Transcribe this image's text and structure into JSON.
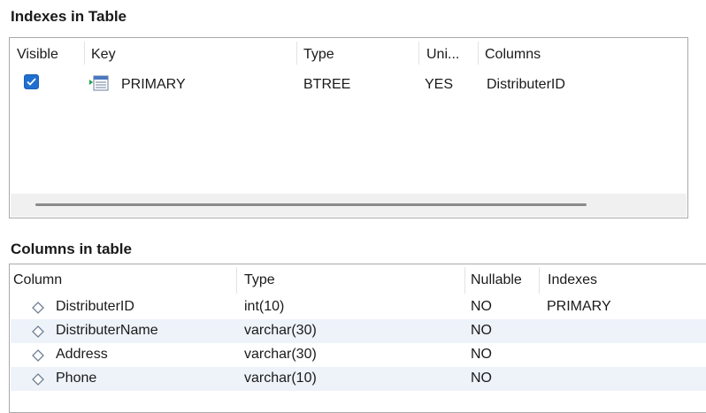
{
  "indexes": {
    "title": "Indexes in Table",
    "columns": [
      "Visible",
      "Key",
      "Type",
      "Uni...",
      "Columns"
    ],
    "rows": [
      {
        "visible": true,
        "key": "PRIMARY",
        "type": "BTREE",
        "unique": "YES",
        "columns": "DistributerID"
      }
    ]
  },
  "table_columns": {
    "title": "Columns in table",
    "columns": [
      "Column",
      "Type",
      "Nullable",
      "Indexes"
    ],
    "rows": [
      {
        "name": "DistributerID",
        "type": "int(10)",
        "nullable": "NO",
        "indexes": "PRIMARY"
      },
      {
        "name": "DistributerName",
        "type": "varchar(30)",
        "nullable": "NO",
        "indexes": ""
      },
      {
        "name": "Address",
        "type": "varchar(30)",
        "nullable": "NO",
        "indexes": ""
      },
      {
        "name": "Phone",
        "type": "varchar(10)",
        "nullable": "NO",
        "indexes": ""
      }
    ]
  },
  "colors": {
    "checkbox": "#1f6fd0",
    "alt_row": "#eef3fa",
    "border": "#a9a9a9"
  },
  "icons": {
    "key": "index-key-icon",
    "column": "column-diamond-icon",
    "check": "checkmark-icon"
  }
}
